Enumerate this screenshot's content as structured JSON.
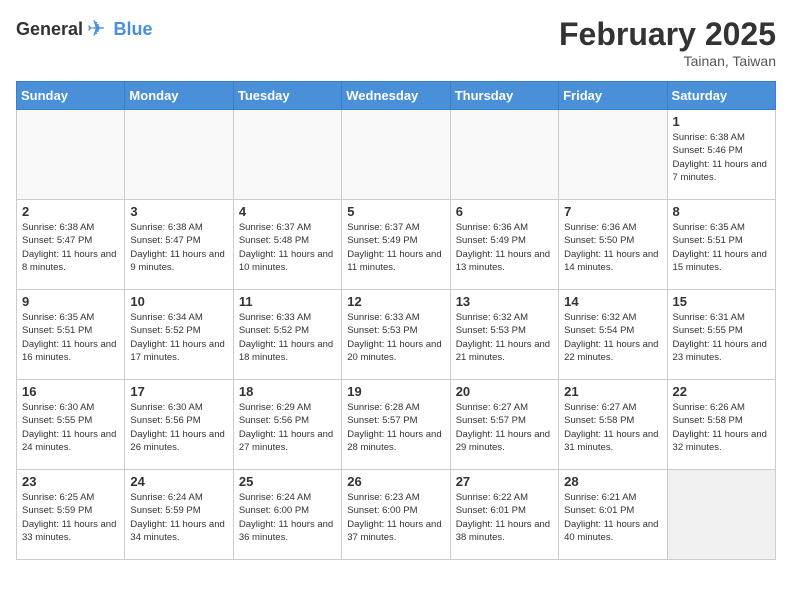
{
  "header": {
    "logo_general": "General",
    "logo_blue": "Blue",
    "title": "February 2025",
    "subtitle": "Tainan, Taiwan"
  },
  "days_of_week": [
    "Sunday",
    "Monday",
    "Tuesday",
    "Wednesday",
    "Thursday",
    "Friday",
    "Saturday"
  ],
  "weeks": [
    [
      {
        "day": "",
        "info": "",
        "empty": true
      },
      {
        "day": "",
        "info": "",
        "empty": true
      },
      {
        "day": "",
        "info": "",
        "empty": true
      },
      {
        "day": "",
        "info": "",
        "empty": true
      },
      {
        "day": "",
        "info": "",
        "empty": true
      },
      {
        "day": "",
        "info": "",
        "empty": true
      },
      {
        "day": "1",
        "info": "Sunrise: 6:38 AM\nSunset: 5:46 PM\nDaylight: 11 hours and 7 minutes."
      }
    ],
    [
      {
        "day": "2",
        "info": "Sunrise: 6:38 AM\nSunset: 5:47 PM\nDaylight: 11 hours and 8 minutes."
      },
      {
        "day": "3",
        "info": "Sunrise: 6:38 AM\nSunset: 5:47 PM\nDaylight: 11 hours and 9 minutes."
      },
      {
        "day": "4",
        "info": "Sunrise: 6:37 AM\nSunset: 5:48 PM\nDaylight: 11 hours and 10 minutes."
      },
      {
        "day": "5",
        "info": "Sunrise: 6:37 AM\nSunset: 5:49 PM\nDaylight: 11 hours and 11 minutes."
      },
      {
        "day": "6",
        "info": "Sunrise: 6:36 AM\nSunset: 5:49 PM\nDaylight: 11 hours and 13 minutes."
      },
      {
        "day": "7",
        "info": "Sunrise: 6:36 AM\nSunset: 5:50 PM\nDaylight: 11 hours and 14 minutes."
      },
      {
        "day": "8",
        "info": "Sunrise: 6:35 AM\nSunset: 5:51 PM\nDaylight: 11 hours and 15 minutes."
      }
    ],
    [
      {
        "day": "9",
        "info": "Sunrise: 6:35 AM\nSunset: 5:51 PM\nDaylight: 11 hours and 16 minutes."
      },
      {
        "day": "10",
        "info": "Sunrise: 6:34 AM\nSunset: 5:52 PM\nDaylight: 11 hours and 17 minutes."
      },
      {
        "day": "11",
        "info": "Sunrise: 6:33 AM\nSunset: 5:52 PM\nDaylight: 11 hours and 18 minutes."
      },
      {
        "day": "12",
        "info": "Sunrise: 6:33 AM\nSunset: 5:53 PM\nDaylight: 11 hours and 20 minutes."
      },
      {
        "day": "13",
        "info": "Sunrise: 6:32 AM\nSunset: 5:53 PM\nDaylight: 11 hours and 21 minutes."
      },
      {
        "day": "14",
        "info": "Sunrise: 6:32 AM\nSunset: 5:54 PM\nDaylight: 11 hours and 22 minutes."
      },
      {
        "day": "15",
        "info": "Sunrise: 6:31 AM\nSunset: 5:55 PM\nDaylight: 11 hours and 23 minutes."
      }
    ],
    [
      {
        "day": "16",
        "info": "Sunrise: 6:30 AM\nSunset: 5:55 PM\nDaylight: 11 hours and 24 minutes."
      },
      {
        "day": "17",
        "info": "Sunrise: 6:30 AM\nSunset: 5:56 PM\nDaylight: 11 hours and 26 minutes."
      },
      {
        "day": "18",
        "info": "Sunrise: 6:29 AM\nSunset: 5:56 PM\nDaylight: 11 hours and 27 minutes."
      },
      {
        "day": "19",
        "info": "Sunrise: 6:28 AM\nSunset: 5:57 PM\nDaylight: 11 hours and 28 minutes."
      },
      {
        "day": "20",
        "info": "Sunrise: 6:27 AM\nSunset: 5:57 PM\nDaylight: 11 hours and 29 minutes."
      },
      {
        "day": "21",
        "info": "Sunrise: 6:27 AM\nSunset: 5:58 PM\nDaylight: 11 hours and 31 minutes."
      },
      {
        "day": "22",
        "info": "Sunrise: 6:26 AM\nSunset: 5:58 PM\nDaylight: 11 hours and 32 minutes."
      }
    ],
    [
      {
        "day": "23",
        "info": "Sunrise: 6:25 AM\nSunset: 5:59 PM\nDaylight: 11 hours and 33 minutes."
      },
      {
        "day": "24",
        "info": "Sunrise: 6:24 AM\nSunset: 5:59 PM\nDaylight: 11 hours and 34 minutes."
      },
      {
        "day": "25",
        "info": "Sunrise: 6:24 AM\nSunset: 6:00 PM\nDaylight: 11 hours and 36 minutes."
      },
      {
        "day": "26",
        "info": "Sunrise: 6:23 AM\nSunset: 6:00 PM\nDaylight: 11 hours and 37 minutes."
      },
      {
        "day": "27",
        "info": "Sunrise: 6:22 AM\nSunset: 6:01 PM\nDaylight: 11 hours and 38 minutes."
      },
      {
        "day": "28",
        "info": "Sunrise: 6:21 AM\nSunset: 6:01 PM\nDaylight: 11 hours and 40 minutes."
      },
      {
        "day": "",
        "info": "",
        "empty": true
      }
    ]
  ]
}
